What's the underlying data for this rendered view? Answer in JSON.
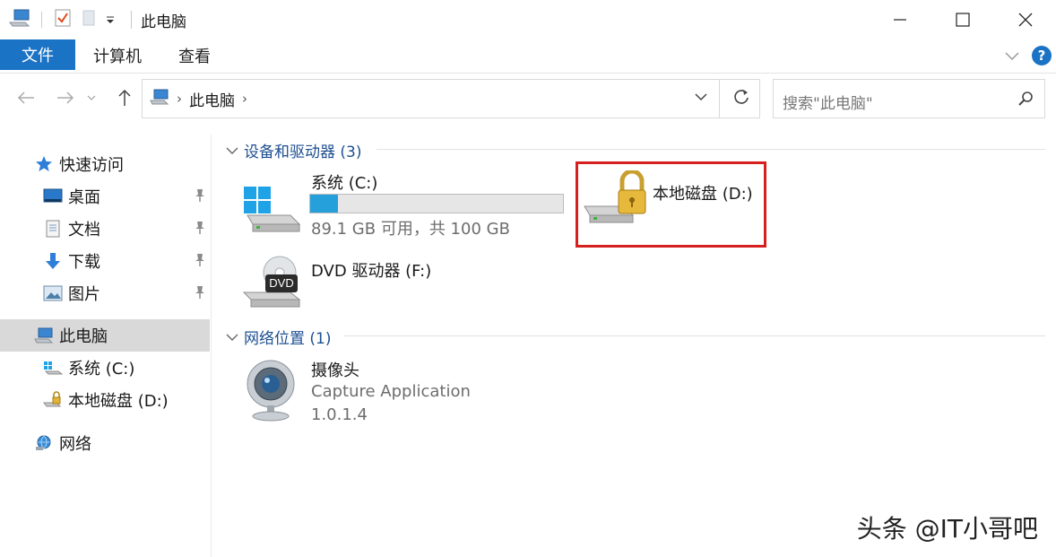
{
  "window": {
    "title": "此电脑",
    "controls": {
      "minimize_icon": "minimize-icon",
      "maximize_icon": "maximize-icon",
      "close_icon": "close-icon"
    }
  },
  "ribbon": {
    "tabs": [
      {
        "label": "文件",
        "active": true
      },
      {
        "label": "计算机"
      },
      {
        "label": "查看"
      }
    ],
    "help_label": "?"
  },
  "address": {
    "crumbs": [
      "此电脑"
    ],
    "search_placeholder": "搜索\"此电脑\""
  },
  "sidebar": {
    "quick_access": "快速访问",
    "pinned": [
      {
        "label": "桌面",
        "icon": "desktop-icon"
      },
      {
        "label": "文档",
        "icon": "document-icon"
      },
      {
        "label": "下载",
        "icon": "download-icon"
      },
      {
        "label": "图片",
        "icon": "pictures-icon"
      }
    ],
    "this_pc": "此电脑",
    "drives": [
      {
        "label": "系统 (C:)",
        "icon": "windows-drive-icon"
      },
      {
        "label": "本地磁盘 (D:)",
        "icon": "locked-drive-icon"
      }
    ],
    "network": "网络"
  },
  "main": {
    "devices_header": "设备和驱动器 (3)",
    "drive_c": {
      "name": "系统 (C:)",
      "usage": "89.1 GB 可用，共 100 GB",
      "used_fraction": 0.109
    },
    "drive_d": {
      "name": "本地磁盘 (D:)"
    },
    "dvd": {
      "name": "DVD 驱动器 (F:)",
      "badge": "DVD"
    },
    "network_header": "网络位置 (1)",
    "camera": {
      "name": "摄像头",
      "app": "Capture Application",
      "version": "1.0.1.4"
    }
  },
  "watermark": "头条 @IT小哥吧",
  "colors": {
    "accent": "#1a73c4",
    "bar_fill": "#26a0da",
    "highlight": "#d61f1f",
    "section": "#1e4f91"
  }
}
